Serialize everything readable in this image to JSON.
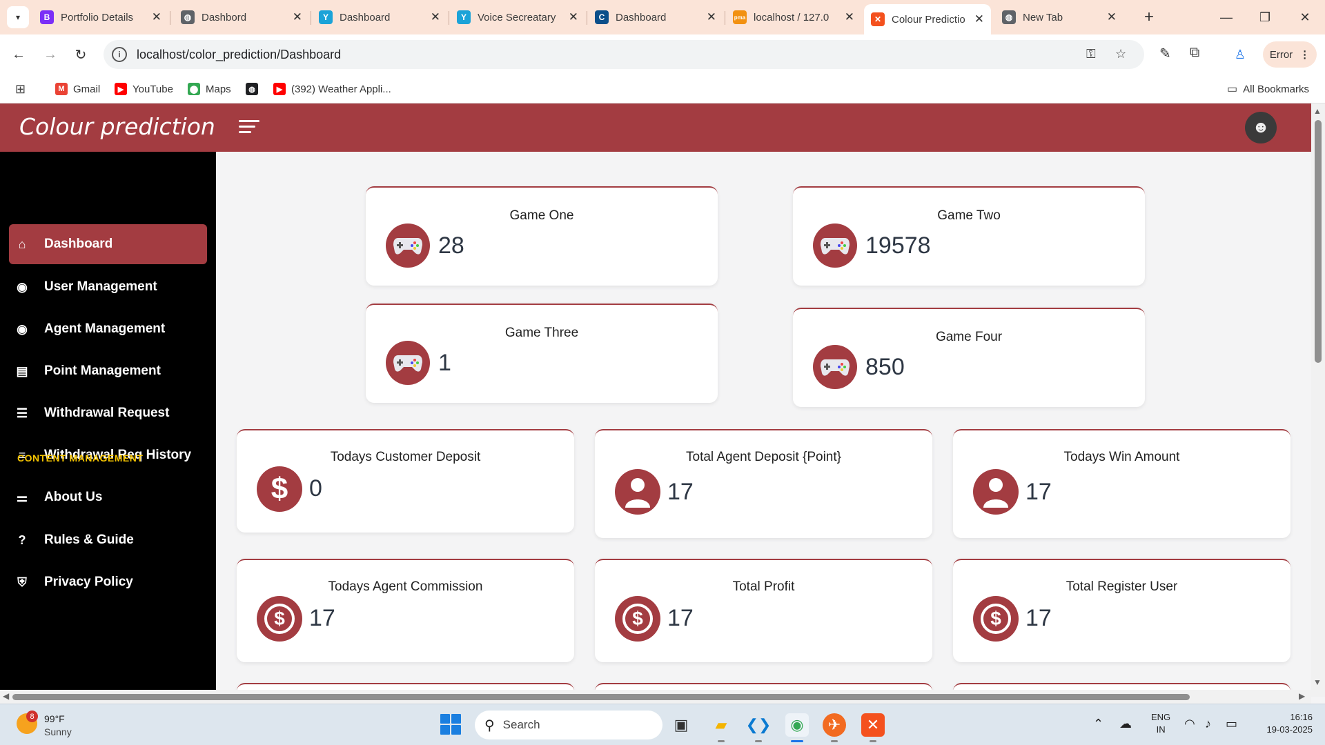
{
  "browser": {
    "tabs": [
      {
        "title": "Portfolio Details",
        "icon": "bootstrap-icon",
        "color": "#7b2ff7",
        "glyph": "B"
      },
      {
        "title": "Dashbord",
        "icon": "globe-icon",
        "color": "#5f6368",
        "glyph": "◍"
      },
      {
        "title": "Dashboard",
        "icon": "app-icon",
        "color": "#1ba3d8",
        "glyph": "Y"
      },
      {
        "title": "Voice Secreatary",
        "icon": "app-icon",
        "color": "#1ba3d8",
        "glyph": "Y"
      },
      {
        "title": "Dashboard",
        "icon": "app-icon",
        "color": "#0b4f8a",
        "glyph": "C"
      },
      {
        "title": "localhost / 127.0",
        "icon": "phpmyadmin-icon",
        "color": "#f29111",
        "glyph": "pma"
      },
      {
        "title": "Colour Predictio",
        "icon": "xampp-icon",
        "color": "#f4511e",
        "glyph": "✕"
      },
      {
        "title": "New Tab",
        "icon": "chrome-icon",
        "color": "#5f6368",
        "glyph": "◍"
      }
    ],
    "active_tab_index": 6,
    "url": "localhost/color_prediction/Dashboard",
    "error_label": "Error",
    "bookmarks": [
      {
        "label": "Gmail",
        "color": "#ea4335",
        "glyph": "M"
      },
      {
        "label": "YouTube",
        "color": "#ff0000",
        "glyph": "▶"
      },
      {
        "label": "Maps",
        "color": "#34a853",
        "glyph": "⬤"
      },
      {
        "label": "",
        "color": "#202124",
        "glyph": "◍"
      },
      {
        "label": "(392) Weather Appli...",
        "color": "#ff0000",
        "glyph": "▶"
      }
    ],
    "all_bookmarks_label": "All Bookmarks"
  },
  "app": {
    "brand": "Colour prediction",
    "accent": "#a33c41",
    "sidebar": {
      "items": [
        {
          "label": "Dashboard",
          "icon": "home-icon",
          "active": true
        },
        {
          "label": "User Management",
          "icon": "user-circle-icon"
        },
        {
          "label": "Agent Management",
          "icon": "user-circle-icon"
        },
        {
          "label": "Point Management",
          "icon": "layout-icon"
        },
        {
          "label": "Withdrawal Request",
          "icon": "list-icon"
        },
        {
          "label": "Withdrawal Req History",
          "icon": "menu-icon"
        }
      ],
      "section_heading": "CONTENT MANAGEMENT",
      "content_items": [
        {
          "label": "About Us",
          "icon": "sliders-icon"
        },
        {
          "label": "Rules & Guide",
          "icon": "help-circle-icon"
        },
        {
          "label": "Privacy Policy",
          "icon": "shield-icon"
        }
      ]
    },
    "game_cards": [
      {
        "title": "Game One",
        "value": "28",
        "icon": "gamepad-icon"
      },
      {
        "title": "Game Two",
        "value": "19578",
        "icon": "gamepad-icon"
      },
      {
        "title": "Game Three",
        "value": "1",
        "icon": "gamepad-icon"
      },
      {
        "title": "Game Four",
        "value": "850",
        "icon": "gamepad-icon"
      }
    ],
    "stat_cards": [
      {
        "title": "Todays Customer Deposit",
        "value": "0",
        "icon": "dollar-icon"
      },
      {
        "title": "Total Agent Deposit {Point}",
        "value": "17",
        "icon": "user-icon"
      },
      {
        "title": "Todays Win Amount",
        "value": "17",
        "icon": "user-icon"
      },
      {
        "title": "Todays Agent Commission",
        "value": "17",
        "icon": "dollar-circle-icon"
      },
      {
        "title": "Total Profit",
        "value": "17",
        "icon": "dollar-circle-icon"
      },
      {
        "title": "Total Register User",
        "value": "17",
        "icon": "dollar-circle-icon"
      }
    ]
  },
  "taskbar": {
    "weather_temp": "99°F",
    "weather_desc": "Sunny",
    "weather_badge": "8",
    "search_placeholder": "Search",
    "lang_line1": "ENG",
    "lang_line2": "IN",
    "time": "16:16",
    "date": "19-03-2025"
  }
}
